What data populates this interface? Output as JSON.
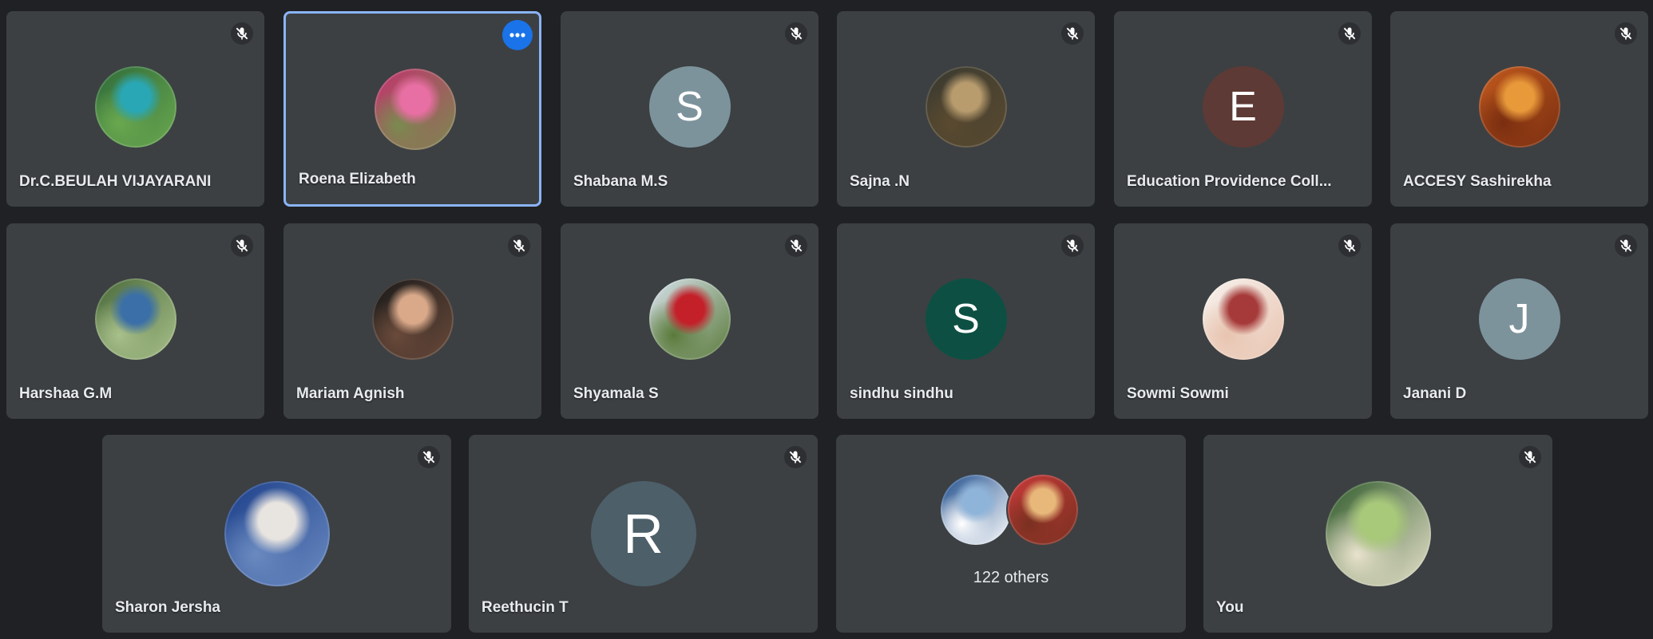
{
  "participants": [
    {
      "name": "Dr.C.BEULAH VIJAYARANI",
      "avatar_type": "photo",
      "colors": [
        "#2f6b3a",
        "#2aa7b5",
        "#6aa84f"
      ]
    },
    {
      "name": "Roena Elizabeth",
      "avatar_type": "photo",
      "colors": [
        "#c2336e",
        "#e86fa3",
        "#7a8a4f"
      ]
    },
    {
      "name": "Shabana M.S",
      "avatar_type": "initial",
      "initial": "S",
      "color": "#7d939c"
    },
    {
      "name": "Sajna .N",
      "avatar_type": "photo",
      "colors": [
        "#3a3a30",
        "#b89c6e",
        "#5a4a30"
      ]
    },
    {
      "name": "Education Providence Coll...",
      "avatar_type": "initial",
      "initial": "E",
      "color": "#5d3a35"
    },
    {
      "name": "ACCESY Sashirekha",
      "avatar_type": "photo",
      "colors": [
        "#c25a1e",
        "#e89a3a",
        "#7a2e10"
      ]
    },
    {
      "name": "Harshaa G.M",
      "avatar_type": "photo",
      "colors": [
        "#4a6a3a",
        "#3b6fa8",
        "#a8c08a"
      ]
    },
    {
      "name": "Mariam Agnish",
      "avatar_type": "photo",
      "colors": [
        "#1a1a1a",
        "#d9a98a",
        "#6a4a3a"
      ]
    },
    {
      "name": "Shyamala S",
      "avatar_type": "photo",
      "colors": [
        "#d8e2ec",
        "#c4202a",
        "#5a7a3a"
      ]
    },
    {
      "name": "sindhu sindhu",
      "avatar_type": "initial",
      "initial": "S",
      "color": "#0d5043"
    },
    {
      "name": "Sowmi Sowmi",
      "avatar_type": "photo",
      "colors": [
        "#f7f2ee",
        "#a63a3a",
        "#e8c4b0"
      ]
    },
    {
      "name": "Janani D",
      "avatar_type": "initial",
      "initial": "J",
      "color": "#7d939c"
    },
    {
      "name": "Sharon Jersha",
      "avatar_type": "photo",
      "colors": [
        "#1c3f8a",
        "#e8e4e0",
        "#6a8ac0"
      ]
    },
    {
      "name": "Reethucin T",
      "avatar_type": "initial",
      "initial": "R",
      "color": "#4d5f69"
    },
    {
      "name": "You",
      "avatar_type": "photo",
      "colors": [
        "#2f5a2a",
        "#a8c87a",
        "#e8e2cc"
      ]
    }
  ],
  "others": {
    "label": "122 others",
    "avatars": [
      {
        "colors": [
          "#1f4e8c",
          "#8fb4d9",
          "#ffffff"
        ]
      },
      {
        "colors": [
          "#c73a3a",
          "#e8b87a",
          "#7a3020"
        ]
      }
    ]
  },
  "active_speaker": "Roena Elizabeth",
  "colors": {
    "background": "#202124",
    "tile": "#3c4043",
    "active_border": "#8ab4f8",
    "more_button": "#1a73e8",
    "text": "#e8eaed"
  },
  "icons": {
    "mute": "mic-off-icon",
    "more": "more-options-icon"
  }
}
